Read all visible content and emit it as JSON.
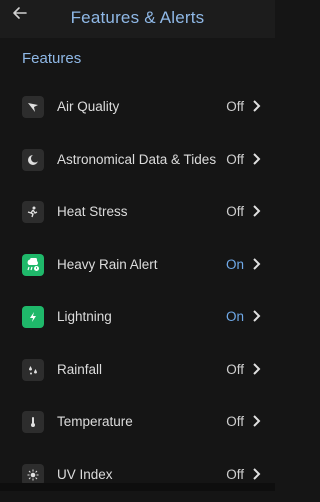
{
  "header": {
    "title": "Features & Alerts",
    "back_icon": "arrow-left-icon"
  },
  "section": {
    "title": "Features"
  },
  "items": [
    {
      "label": "Air Quality",
      "status": "Off",
      "icon": "air-quality-icon",
      "green": false,
      "on": false
    },
    {
      "label": "Astronomical Data & Tides",
      "status": "Off",
      "icon": "moon-icon",
      "green": false,
      "on": false
    },
    {
      "label": "Heat Stress",
      "status": "Off",
      "icon": "heat-stress-icon",
      "green": false,
      "on": false
    },
    {
      "label": "Heavy Rain Alert",
      "status": "On",
      "icon": "heavy-rain-alert-icon",
      "green": true,
      "on": true
    },
    {
      "label": "Lightning",
      "status": "On",
      "icon": "lightning-icon",
      "green": true,
      "on": true
    },
    {
      "label": "Rainfall",
      "status": "Off",
      "icon": "rainfall-icon",
      "green": false,
      "on": false
    },
    {
      "label": "Temperature",
      "status": "Off",
      "icon": "thermometer-icon",
      "green": false,
      "on": false
    },
    {
      "label": "UV Index",
      "status": "Off",
      "icon": "sun-icon",
      "green": false,
      "on": false
    }
  ],
  "colors": {
    "accent": "#8fb8e6",
    "on": "#6fa9e8",
    "green": "#1fb86a"
  }
}
